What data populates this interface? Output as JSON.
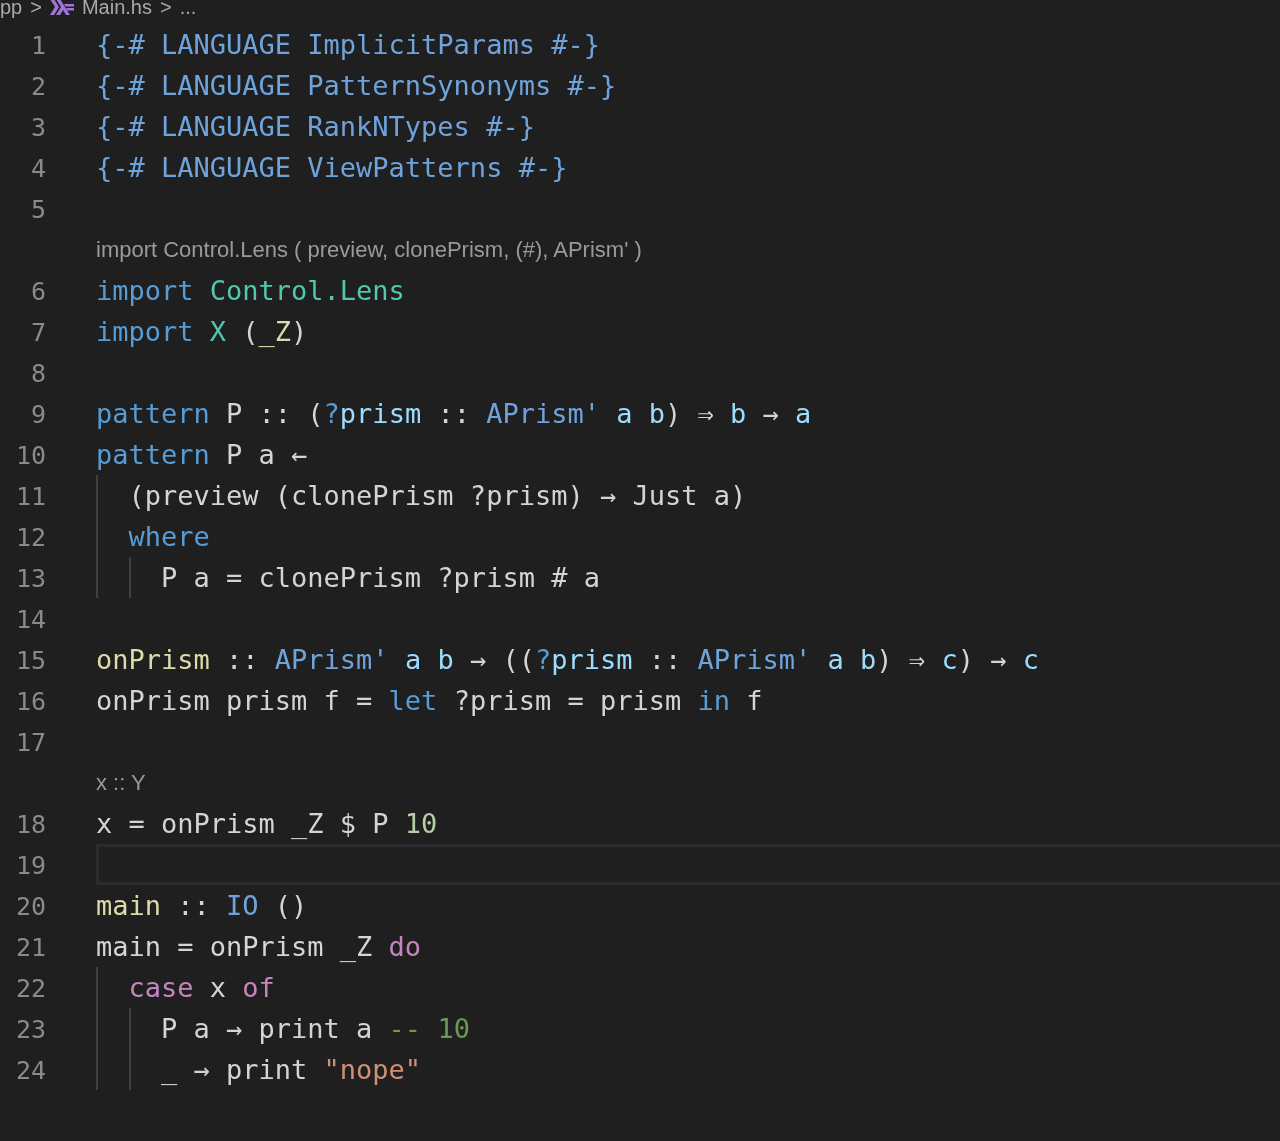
{
  "breadcrumb": {
    "items": [
      {
        "text": "pp",
        "kind": "folder"
      },
      {
        "text": ">",
        "kind": "separator"
      },
      {
        "text": "Main.hs",
        "kind": "file"
      },
      {
        "text": ">",
        "kind": "separator"
      },
      {
        "text": "...",
        "kind": "more"
      }
    ]
  },
  "lines": [
    {
      "kind": "code",
      "number": "1",
      "current": false,
      "tokens": [
        {
          "text": "{-# LANGUAGE ImplicitParams #-}",
          "kind": "pragma"
        }
      ]
    },
    {
      "kind": "code",
      "number": "2",
      "current": false,
      "tokens": [
        {
          "text": "{-# LANGUAGE PatternSynonyms #-}",
          "kind": "pragma"
        }
      ]
    },
    {
      "kind": "code",
      "number": "3",
      "current": false,
      "tokens": [
        {
          "text": "{-# LANGUAGE RankNTypes #-}",
          "kind": "pragma"
        }
      ]
    },
    {
      "kind": "code",
      "number": "4",
      "current": false,
      "tokens": [
        {
          "text": "{-# LANGUAGE ViewPatterns #-}",
          "kind": "pragma"
        }
      ]
    },
    {
      "kind": "code",
      "number": "5",
      "current": false
    },
    {
      "kind": "lens",
      "text": "import Control.Lens ( preview, clonePrism, (#), APrism' )"
    },
    {
      "kind": "code",
      "number": "6",
      "current": false,
      "tokens": [
        {
          "text": "import ",
          "kind": "keyword"
        },
        {
          "text": "Control.Lens",
          "kind": "module"
        }
      ]
    },
    {
      "kind": "code",
      "number": "7",
      "current": false,
      "tokens": [
        {
          "text": "import ",
          "kind": "keyword"
        },
        {
          "text": "X",
          "kind": "module"
        },
        {
          "text": " (",
          "kind": "plain"
        },
        {
          "text": "_Z",
          "kind": "function"
        },
        {
          "text": ")",
          "kind": "plain"
        }
      ]
    },
    {
      "kind": "code",
      "number": "8",
      "current": false
    },
    {
      "kind": "code",
      "number": "9",
      "current": false,
      "tokens": [
        {
          "text": "pattern",
          "kind": "keyword"
        },
        {
          "text": " P :: (",
          "kind": "plain"
        },
        {
          "text": "?",
          "kind": "keyword"
        },
        {
          "text": "prism",
          "kind": "variable"
        },
        {
          "text": " :: ",
          "kind": "plain"
        },
        {
          "text": "APrism'",
          "kind": "type"
        },
        {
          "text": " a b",
          "kind": "variable"
        },
        {
          "text": ") ⇒ ",
          "kind": "plain"
        },
        {
          "text": "b",
          "kind": "variable"
        },
        {
          "text": " → ",
          "kind": "plain"
        },
        {
          "text": "a",
          "kind": "variable"
        }
      ]
    },
    {
      "kind": "code",
      "number": "10",
      "current": false,
      "tokens": [
        {
          "text": "pattern",
          "kind": "keyword"
        },
        {
          "text": " P a ←",
          "kind": "plain"
        }
      ]
    },
    {
      "kind": "code",
      "number": "11",
      "current": false,
      "tokens": [
        {
          "text": "  (preview (clonePrism ?prism) → Just a)",
          "kind": "plain"
        }
      ]
    },
    {
      "kind": "code",
      "number": "12",
      "current": false,
      "tokens": [
        {
          "text": "  where",
          "kind": "keyword"
        }
      ]
    },
    {
      "kind": "code",
      "number": "13",
      "current": false,
      "tokens": [
        {
          "text": "    P a = clonePrism ?prism # a",
          "kind": "plain"
        }
      ]
    },
    {
      "kind": "code",
      "number": "14",
      "current": false
    },
    {
      "kind": "code",
      "number": "15",
      "current": false,
      "tokens": [
        {
          "text": "onPrism",
          "kind": "function"
        },
        {
          "text": " :: ",
          "kind": "plain"
        },
        {
          "text": "APrism'",
          "kind": "type"
        },
        {
          "text": " a b",
          "kind": "variable"
        },
        {
          "text": " → ((",
          "kind": "plain"
        },
        {
          "text": "?",
          "kind": "keyword"
        },
        {
          "text": "prism",
          "kind": "variable"
        },
        {
          "text": " :: ",
          "kind": "plain"
        },
        {
          "text": "APrism'",
          "kind": "type"
        },
        {
          "text": " a b",
          "kind": "variable"
        },
        {
          "text": ") ⇒ ",
          "kind": "plain"
        },
        {
          "text": "c",
          "kind": "variable"
        },
        {
          "text": ") → ",
          "kind": "plain"
        },
        {
          "text": "c",
          "kind": "variable"
        }
      ]
    },
    {
      "kind": "code",
      "number": "16",
      "current": false,
      "tokens": [
        {
          "text": "onPrism prism f = ",
          "kind": "plain"
        },
        {
          "text": "let",
          "kind": "keyword"
        },
        {
          "text": " ?prism = prism ",
          "kind": "plain"
        },
        {
          "text": "in",
          "kind": "keyword"
        },
        {
          "text": " f",
          "kind": "plain"
        }
      ]
    },
    {
      "kind": "code",
      "number": "17",
      "current": false
    },
    {
      "kind": "lens",
      "text": "x :: Y"
    },
    {
      "kind": "code",
      "number": "18",
      "current": false,
      "tokens": [
        {
          "text": "x = onPrism _Z $ P ",
          "kind": "plain"
        },
        {
          "text": "10",
          "kind": "number"
        }
      ]
    },
    {
      "kind": "code",
      "number": "19",
      "current": true
    },
    {
      "kind": "code",
      "number": "20",
      "current": false,
      "tokens": [
        {
          "text": "main",
          "kind": "function"
        },
        {
          "text": " :: ",
          "kind": "plain"
        },
        {
          "text": "IO",
          "kind": "type"
        },
        {
          "text": " ()",
          "kind": "plain"
        }
      ]
    },
    {
      "kind": "code",
      "number": "21",
      "current": false,
      "tokens": [
        {
          "text": "main = onPrism _Z ",
          "kind": "plain"
        },
        {
          "text": "do",
          "kind": "control"
        }
      ]
    },
    {
      "kind": "code",
      "number": "22",
      "current": false,
      "tokens": [
        {
          "text": "  case",
          "kind": "control"
        },
        {
          "text": " x ",
          "kind": "plain"
        },
        {
          "text": "of",
          "kind": "control"
        }
      ]
    },
    {
      "kind": "code",
      "number": "23",
      "current": false,
      "tokens": [
        {
          "text": "    P a → print a ",
          "kind": "plain"
        },
        {
          "text": "-- 10",
          "kind": "comment"
        }
      ]
    },
    {
      "kind": "code",
      "number": "24",
      "current": false,
      "tokens": [
        {
          "text": "    _ → print ",
          "kind": "plain"
        },
        {
          "text": "\"nope\"",
          "kind": "string"
        }
      ]
    }
  ]
}
